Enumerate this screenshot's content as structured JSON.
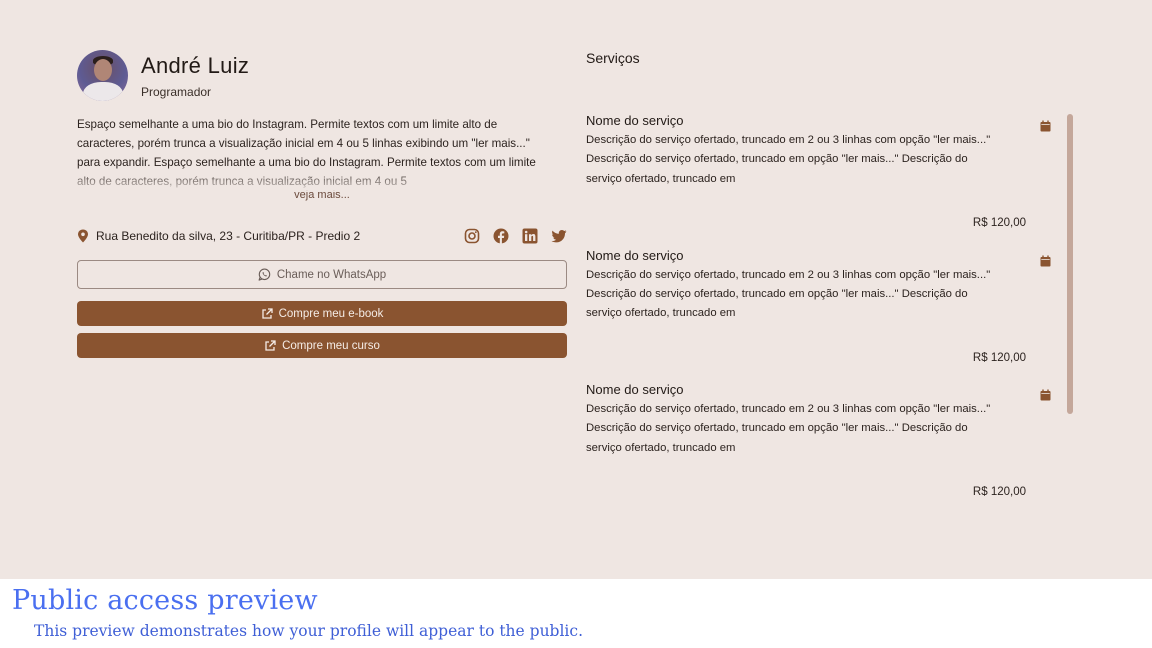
{
  "profile": {
    "name": "André Luiz",
    "role": "Programador",
    "bio": "Espaço semelhante a uma bio do Instagram. Permite textos com um limite alto de caracteres, porém trunca a visualização inicial em 4 ou 5 linhas exibindo um \"ler mais...\" para expandir. Espaço semelhante a uma bio do Instagram. Permite textos com um limite alto de caracteres, porém trunca a visualização inicial em 4 ou 5",
    "see_more": "veja mais...",
    "address": "Rua Benedito da silva, 23 - Curitiba/PR - Predio 2",
    "socials": [
      "instagram-icon",
      "facebook-icon",
      "linkedin-icon",
      "twitter-icon"
    ],
    "buttons": {
      "whatsapp": "Chame no WhatsApp",
      "ebook": "Compre meu e-book",
      "course": "Compre meu curso"
    }
  },
  "services": {
    "title": "Serviços",
    "items": [
      {
        "name": "Nome do serviço",
        "description": "Descrição do serviço ofertado, truncado em 2 ou 3 linhas com opção \"ler mais...\" Descrição do serviço ofertado, truncado em opção \"ler mais...\" Descrição do serviço ofertado, truncado em",
        "price": "R$ 120,00"
      },
      {
        "name": "Nome do serviço",
        "description": "Descrição do serviço ofertado, truncado em 2 ou 3 linhas com opção \"ler mais...\" Descrição do serviço ofertado, truncado em opção \"ler mais...\" Descrição do serviço ofertado, truncado em",
        "price": "R$ 120,00"
      },
      {
        "name": "Nome do serviço",
        "description": "Descrição do serviço ofertado, truncado em 2 ou 3 linhas com opção \"ler mais...\" Descrição do serviço ofertado, truncado em opção \"ler mais...\" Descrição do serviço ofertado, truncado em",
        "price": "R$ 120,00"
      }
    ]
  },
  "caption": {
    "title": "Public access preview",
    "subtitle": "This preview demonstrates how your profile will appear to the public."
  },
  "colors": {
    "background": "#efe6e2",
    "accent": "#8a5430",
    "caption_text": "#4a6ff0"
  }
}
